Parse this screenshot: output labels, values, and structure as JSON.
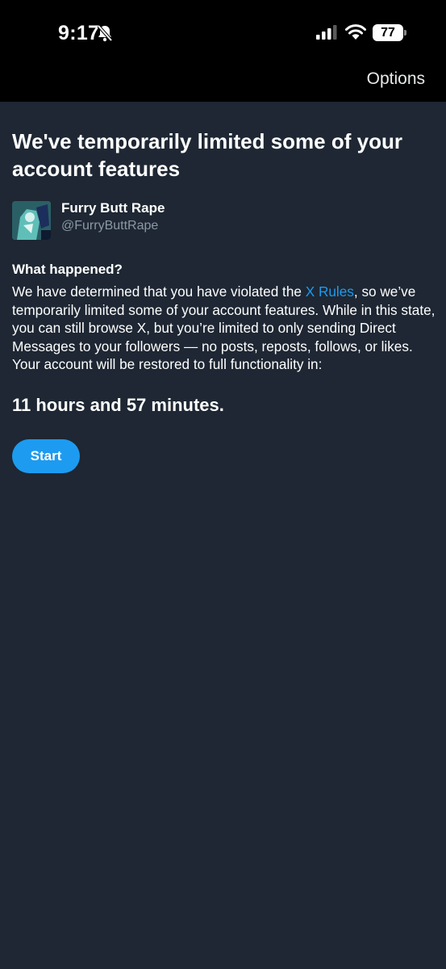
{
  "status_bar": {
    "time": "9:17",
    "battery_level": "77",
    "icons": [
      "bell-slash-icon",
      "cellular-signal-icon",
      "wifi-icon",
      "battery-icon"
    ]
  },
  "nav": {
    "options_label": "Options"
  },
  "notice": {
    "title": "We've temporarily limited some of your account features",
    "account": {
      "display_name": "Furry Butt Rape",
      "handle": "@FurryButtRape"
    },
    "section_heading": "What happened?",
    "body_before_link": "We have determined that you have violated the ",
    "link_text": "X Rules",
    "body_after_link": ", so we’ve temporarily limited some of your account features. While in this state, you can still browse X, but you’re limited to only sending Direct Messages to your followers — no posts, reposts, follows, or likes. Your account will be restored to full functionality in:",
    "countdown": "11 hours and 57 minutes.",
    "start_label": "Start"
  },
  "colors": {
    "background": "#1e2733",
    "header": "#000000",
    "accent": "#1d9bf0",
    "secondary_text": "#8b98a5"
  }
}
